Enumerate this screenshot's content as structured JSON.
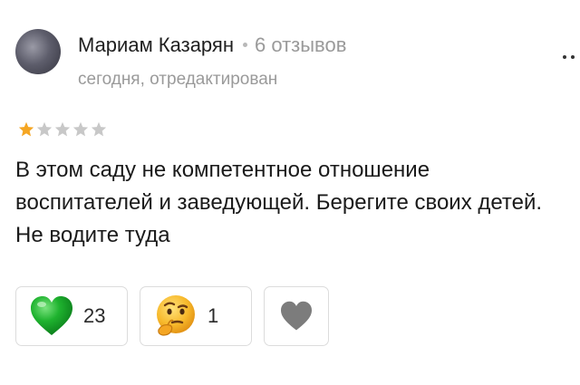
{
  "author": {
    "name": "Мариам Казарян",
    "reviews_count": "6 отзывов"
  },
  "meta": {
    "date_status": "сегодня, отредактирован"
  },
  "rating": {
    "value": 1,
    "max": 5
  },
  "review": {
    "text": "В этом саду не компетентное отношение воспитателей и заведующей. Берегите своих детей. Не водите туда"
  },
  "reactions": [
    {
      "icon": "green-heart-icon",
      "count": "23"
    },
    {
      "icon": "thinking-face-icon",
      "count": "1"
    },
    {
      "icon": "gray-heart-icon",
      "count": ""
    }
  ],
  "colors": {
    "star_filled": "#f5a623",
    "star_empty": "#c8c8c8",
    "green_heart": "#1fb32f",
    "gray_heart": "#7c7c7c",
    "muted_text": "#9a9a9a"
  }
}
